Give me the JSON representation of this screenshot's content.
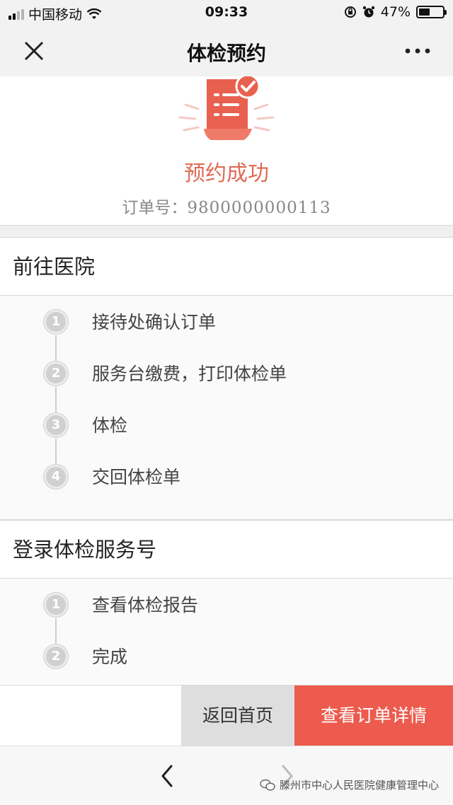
{
  "status_bar": {
    "carrier": "中国移动",
    "time": "09:33",
    "battery_percent": "47%",
    "battery_level": 0.47
  },
  "nav": {
    "title": "体检预约",
    "close_icon": "close-icon",
    "more_icon": "more-icon"
  },
  "success": {
    "title": "预约成功",
    "order_label": "订单号：",
    "order_number": "9800000000113",
    "icon": "document-check-icon",
    "accent_color": "#e06a55"
  },
  "sections": [
    {
      "title": "前往医院",
      "steps": [
        {
          "num": "1",
          "label": "接待处确认订单"
        },
        {
          "num": "2",
          "label": "服务台缴费，打印体检单"
        },
        {
          "num": "3",
          "label": "体检"
        },
        {
          "num": "4",
          "label": "交回体检单"
        }
      ]
    },
    {
      "title": "登录体检服务号",
      "steps": [
        {
          "num": "1",
          "label": "查看体检报告"
        },
        {
          "num": "2",
          "label": "完成"
        }
      ]
    }
  ],
  "actions": {
    "home_label": "返回首页",
    "detail_label": "查看订单详情",
    "detail_color": "#ec5b4d"
  },
  "browser": {
    "back_icon": "chevron-left-icon",
    "forward_icon": "chevron-right-icon",
    "watermark": "滕州市中心人民医院健康管理中心"
  }
}
